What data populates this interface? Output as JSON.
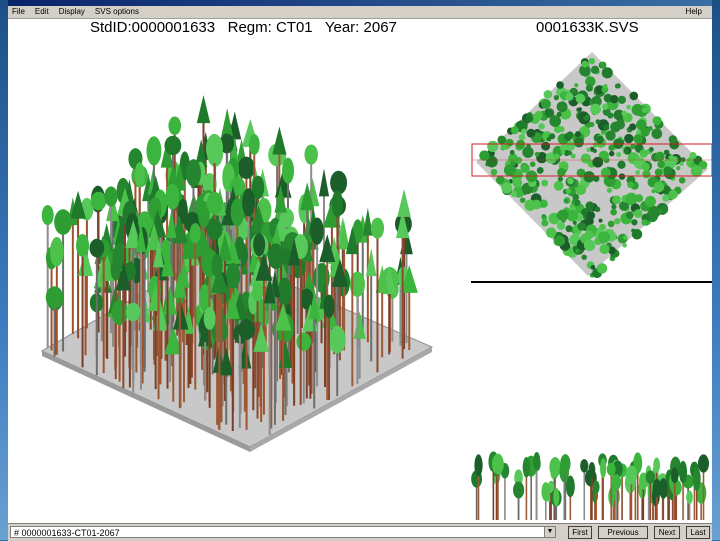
{
  "window": {
    "menu": [
      "File",
      "Edit",
      "Display",
      "SVS options"
    ],
    "help_label": "Help"
  },
  "header": {
    "stand_info": "StdID:0000001633   Regm: CT01   Year: 2067",
    "file_name": "0001633K.SVS"
  },
  "statusbar": {
    "stand_selector_value": "# 0000001633-CT01-2067",
    "buttons": [
      "First",
      "Previous",
      "Next",
      "Last"
    ]
  },
  "colors": {
    "ground": "#c8c8c8",
    "canopy_light": "#36b33a",
    "canopy_dark": "#1f6b2a",
    "trunk": "#8a4b2e",
    "selection_rect": "#d02020"
  }
}
